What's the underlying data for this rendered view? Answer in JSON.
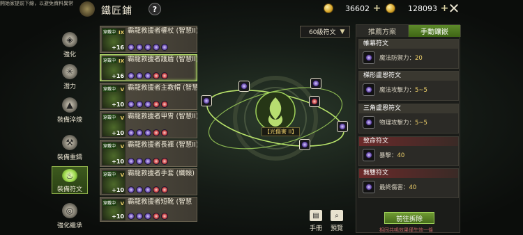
{
  "notice": "開始家提前下線，以避免資料異常",
  "header": {
    "title": "鐵匠鋪",
    "help": "?"
  },
  "currency": {
    "amount1": "36602",
    "amount2": "128093"
  },
  "sidebar": {
    "items": [
      {
        "label": "強化",
        "icon": "shield-icon"
      },
      {
        "label": "潛力",
        "icon": "web-icon"
      },
      {
        "label": "裝備淬煉",
        "icon": "anvil-icon"
      },
      {
        "label": "裝備重鑄",
        "icon": "hammer-icon"
      },
      {
        "label": "裝備符文",
        "icon": "rune-flame-icon"
      },
      {
        "label": "強化繼承",
        "icon": "inherit-icon"
      }
    ]
  },
  "equipment": [
    {
      "tag": "穿戴中",
      "grade": "IX",
      "level": "+16",
      "name": "霸龍救援者權杖 (智慧II)"
    },
    {
      "tag": "穿戴中",
      "grade": "IX",
      "level": "+16",
      "name": "霸龍救援者護盾 (智慧II)"
    },
    {
      "tag": "穿戴中",
      "grade": "V",
      "level": "+10",
      "name": "霸龍救援者主教帽 (智慧II)"
    },
    {
      "tag": "穿戴中",
      "grade": "V",
      "level": "+10",
      "name": "霸龍救援者甲冑 (智慧II)"
    },
    {
      "tag": "穿戴中",
      "grade": "V",
      "level": "+10",
      "name": "霸龍救援者長褲 (智慧II)"
    },
    {
      "tag": "穿戴中",
      "grade": "V",
      "level": "+10",
      "name": "霸龍救援者手套 (纖轅)"
    },
    {
      "tag": "穿戴中",
      "grade": "V",
      "level": "+10",
      "name": "霸龍救援者短靴 (智慧"
    }
  ],
  "center": {
    "label": "【光傷害 II】"
  },
  "sort": {
    "selected": "60級符文"
  },
  "bottom": {
    "manual": "手冊",
    "preview": "預覽"
  },
  "panel": {
    "tabs": [
      "推薦方案",
      "手動鑲嵌"
    ],
    "runes": [
      {
        "title": "帷幕符文",
        "stat": "魔法防禦力：",
        "value": "20"
      },
      {
        "title": "梯形盧恩符文",
        "stat": "魔法攻擊力：",
        "value": "5~5"
      },
      {
        "title": "三角盧恩符文",
        "stat": "物理攻擊力：",
        "value": "5~5"
      },
      {
        "title": "致命符文",
        "stat": "暴擊：",
        "value": "40"
      },
      {
        "title": "無雙符文",
        "stat": "最終傷害：",
        "value": "40"
      }
    ],
    "go_button": "前往拆除",
    "footnote": "相同共鳴效果僅生效一條"
  },
  "colors": {
    "accent": "#8fb04a",
    "gold": "#f2d36b",
    "danger": "#6b2a2a"
  }
}
